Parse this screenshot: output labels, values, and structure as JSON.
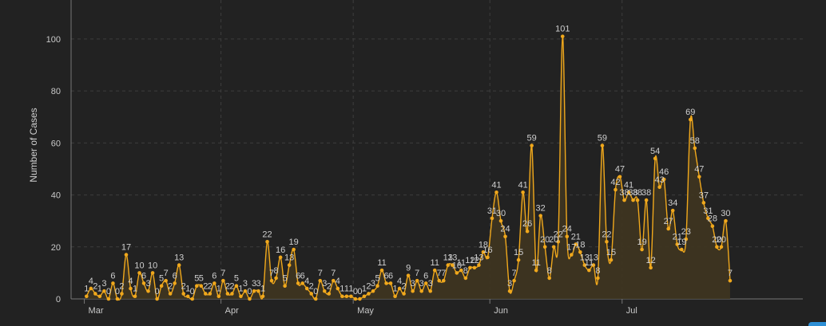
{
  "chart_data": {
    "type": "area",
    "title": "",
    "xlabel": "",
    "ylabel": "Number of Cases",
    "ylim": [
      0,
      115
    ],
    "yticks": [
      0,
      20,
      40,
      60,
      80,
      100
    ],
    "xlim": [
      -3.5,
      162.5
    ],
    "grid": true,
    "legend": "none",
    "colors": {
      "background": "#222222",
      "line": "#f0a81c",
      "fill": "#3f3520",
      "grid": "#3d3d3d",
      "axis": "#777777",
      "text": "#c8c8c8"
    },
    "month_ticks": [
      {
        "label": "Mar",
        "day": 0
      },
      {
        "label": "Apr",
        "day": 31
      },
      {
        "label": "May",
        "day": 61
      },
      {
        "label": "Jun",
        "day": 92
      },
      {
        "label": "Jul",
        "day": 122
      }
    ],
    "series": [
      {
        "values": [
          1,
          4,
          2,
          1,
          3,
          0,
          6,
          0,
          2,
          17,
          4,
          1,
          10,
          6,
          3,
          10,
          0,
          5,
          7,
          2,
          6,
          13,
          2,
          1,
          0,
          5,
          5,
          2,
          2,
          6,
          1,
          7,
          2,
          2,
          5,
          1,
          3,
          0,
          3,
          3,
          1,
          22,
          7,
          8,
          16,
          5,
          13,
          19,
          6,
          6,
          4,
          2,
          0,
          7,
          3,
          2,
          7,
          4,
          1,
          1,
          1,
          0,
          0,
          1,
          2,
          3,
          5,
          11,
          6,
          6,
          1,
          4,
          2,
          9,
          3,
          7,
          3,
          6,
          3,
          11,
          7,
          7,
          13,
          13,
          10,
          11,
          8,
          12,
          12,
          13,
          18,
          16,
          31,
          41,
          30,
          24,
          3,
          7,
          15,
          41,
          26,
          59,
          11,
          32,
          20,
          8,
          20,
          22,
          101,
          24,
          17,
          21,
          18,
          13,
          11,
          13,
          8,
          59,
          22,
          15,
          42,
          47,
          38,
          41,
          38,
          38,
          19,
          38,
          12,
          54,
          43,
          46,
          27,
          34,
          21,
          19,
          23,
          69,
          58,
          47,
          37,
          31,
          28,
          20,
          20,
          30,
          7
        ]
      }
    ]
  }
}
